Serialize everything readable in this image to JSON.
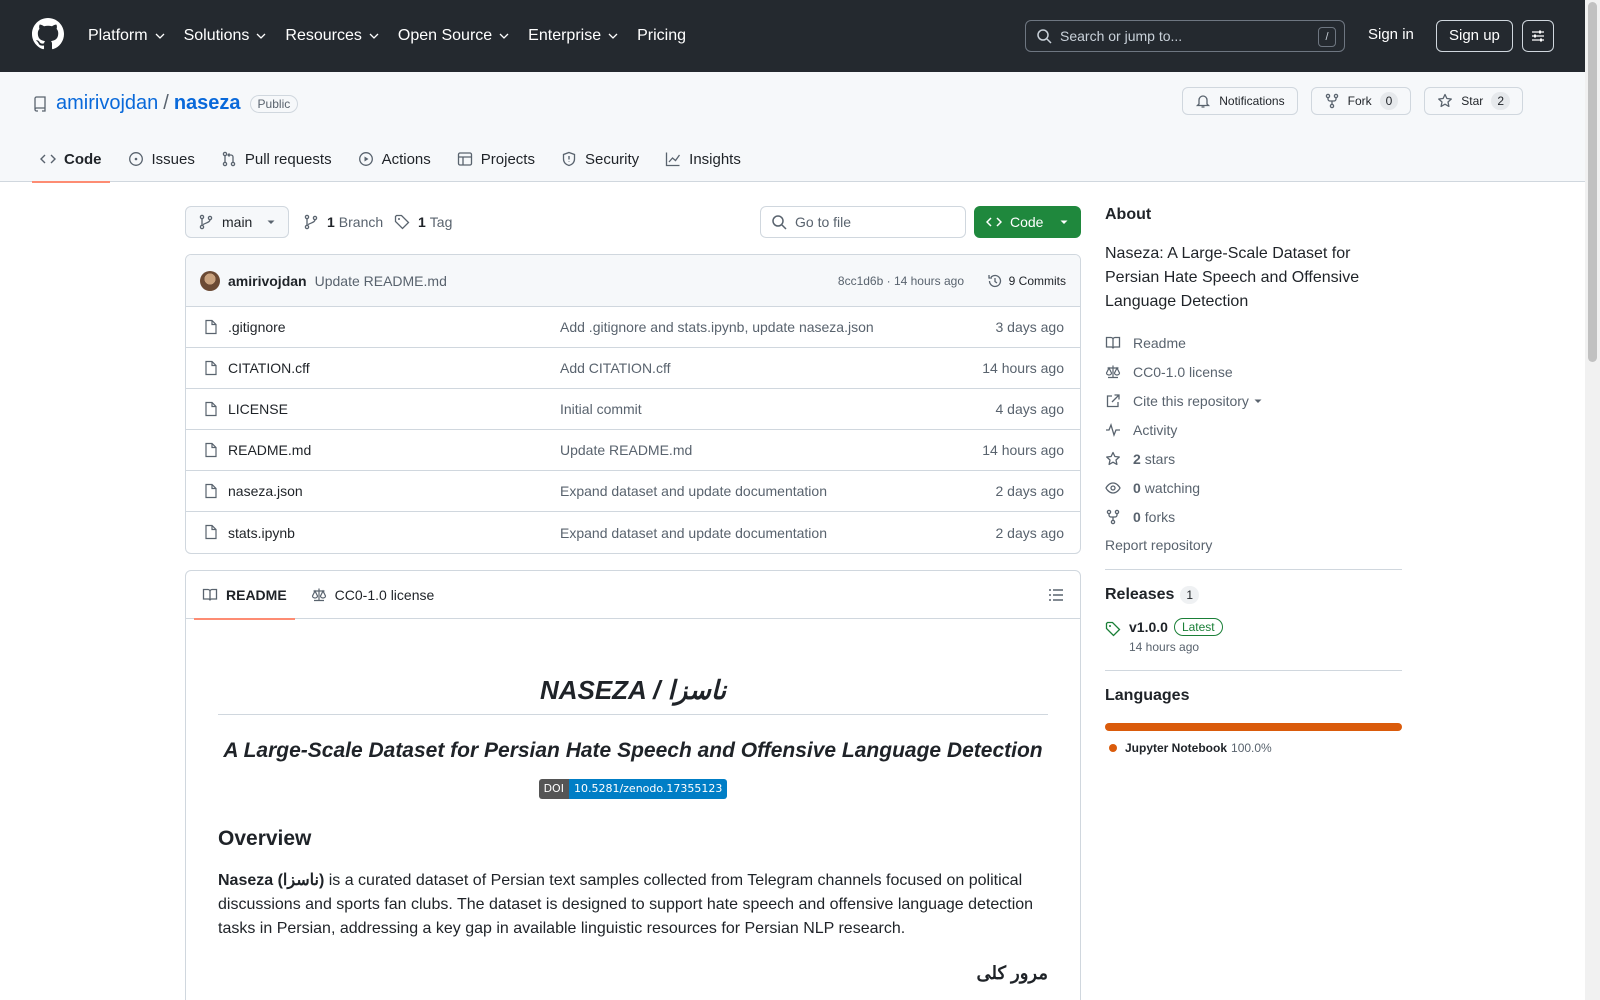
{
  "global_nav": {
    "items": [
      "Platform",
      "Solutions",
      "Resources",
      "Open Source",
      "Enterprise",
      "Pricing"
    ],
    "search_placeholder": "Search or jump to...",
    "search_shortcut": "/",
    "sign_in": "Sign in",
    "sign_up": "Sign up"
  },
  "repo": {
    "owner": "amirivojdan",
    "separator": "/",
    "name": "naseza",
    "visibility": "Public",
    "notifications_label": "Notifications",
    "fork_label": "Fork",
    "fork_count": "0",
    "star_label": "Star",
    "star_count": "2",
    "tabs": [
      {
        "label": "Code",
        "icon": "code-icon",
        "active": true
      },
      {
        "label": "Issues",
        "icon": "issue-icon"
      },
      {
        "label": "Pull requests",
        "icon": "pull-request-icon"
      },
      {
        "label": "Actions",
        "icon": "play-icon"
      },
      {
        "label": "Projects",
        "icon": "table-icon"
      },
      {
        "label": "Security",
        "icon": "shield-icon"
      },
      {
        "label": "Insights",
        "icon": "graph-icon"
      }
    ]
  },
  "toolbar": {
    "branch": "main",
    "branch_count": "1",
    "branch_label": "Branch",
    "tag_count": "1",
    "tag_label": "Tag",
    "goto_placeholder": "Go to file",
    "code_button": "Code"
  },
  "latest_commit": {
    "author": "amirivojdan",
    "message": "Update README.md",
    "meta": "8cc1d6b · 14 hours ago",
    "commits_label": "9 Commits"
  },
  "files": [
    {
      "name": ".gitignore",
      "message": "Add .gitignore and stats.ipynb, update naseza.json",
      "time": "3 days ago"
    },
    {
      "name": "CITATION.cff",
      "message": "Add CITATION.cff",
      "time": "14 hours ago"
    },
    {
      "name": "LICENSE",
      "message": "Initial commit",
      "time": "4 days ago"
    },
    {
      "name": "README.md",
      "message": "Update README.md",
      "time": "14 hours ago"
    },
    {
      "name": "naseza.json",
      "message": "Expand dataset and update documentation",
      "time": "2 days ago"
    },
    {
      "name": "stats.ipynb",
      "message": "Expand dataset and update documentation",
      "time": "2 days ago"
    }
  ],
  "readme": {
    "tab_readme": "README",
    "tab_license": "CC0-1.0 license",
    "title": "NASEZA / ناسزا",
    "subtitle": "A Large-Scale Dataset for Persian Hate Speech and Offensive Language Detection",
    "doi_label": "DOI",
    "doi_value": "10.5281/zenodo.17355123",
    "overview_heading": "Overview",
    "overview_bold": "Naseza (ناسزا)",
    "overview_text": " is a curated dataset of Persian text samples collected from Telegram channels focused on political discussions and sports fan clubs. The dataset is designed to support hate speech and offensive language detection tasks in Persian, addressing a key gap in available linguistic resources for Persian NLP research.",
    "persian_heading": "مرور کلی"
  },
  "about": {
    "heading": "About",
    "description": "Naseza: A Large-Scale Dataset for Persian Hate Speech and Offensive Language Detection",
    "readme": "Readme",
    "license": "CC0-1.0 license",
    "cite": "Cite this repository",
    "activity": "Activity",
    "stars_count": "2",
    "stars_label": "stars",
    "watching_count": "0",
    "watching_label": "watching",
    "forks_count": "0",
    "forks_label": "forks",
    "report": "Report repository"
  },
  "releases": {
    "heading": "Releases",
    "count": "1",
    "version": "v1.0.0",
    "badge": "Latest",
    "time": "14 hours ago"
  },
  "languages": {
    "heading": "Languages",
    "items": [
      {
        "name": "Jupyter Notebook",
        "percent": "100.0%",
        "share": 1.0,
        "color": "#da5b0b"
      }
    ]
  },
  "colors": {
    "header_bg": "#24292f",
    "link": "#0969da",
    "primary_button": "#1f883d",
    "active_tab_underline": "#fd8c73",
    "latest_badge": "#1a7f37"
  }
}
